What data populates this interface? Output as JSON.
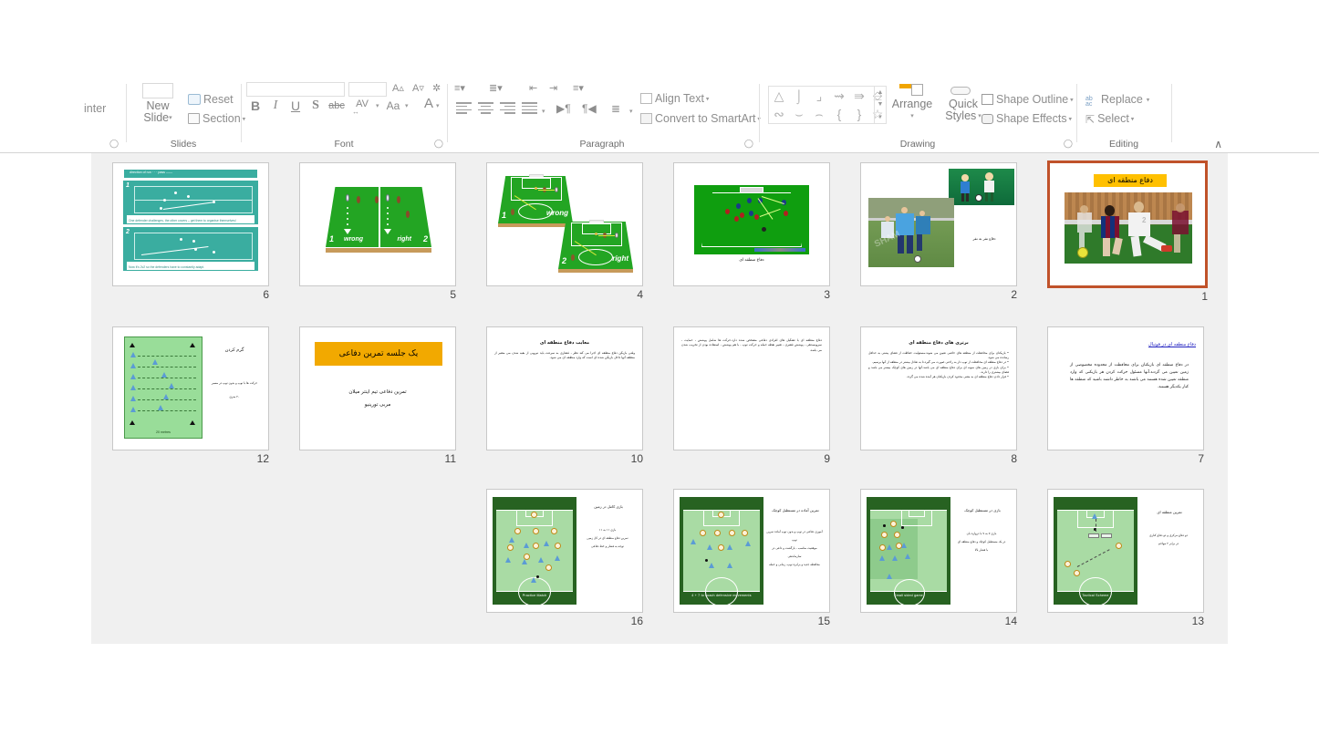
{
  "app": {
    "name": "PowerPoint",
    "view": "slide-sorter"
  },
  "ribbon": {
    "groups": [
      {
        "label": "Slides"
      },
      {
        "label": "Font"
      },
      {
        "label": "Paragraph"
      },
      {
        "label": "Drawing"
      },
      {
        "label": "Editing"
      }
    ],
    "clipboard": {
      "painter_label": "inter"
    },
    "slides_group": {
      "new_slide_line1": "New",
      "new_slide_line2": "Slide",
      "reset_label": "Reset",
      "section_label": "Section",
      "label": "Slides"
    },
    "font_group": {
      "bold": "B",
      "italic": "I",
      "underline": "U",
      "shadow": "S",
      "strikethrough": "abc",
      "char_spacing": "AV",
      "change_case": "Aa",
      "font_color": "A",
      "label": "Font"
    },
    "paragraph_group": {
      "align_text_label": "Align Text",
      "convert_smartart_label": "Convert to SmartArt",
      "label": "Paragraph"
    },
    "drawing_group": {
      "arrange_label": "Arrange",
      "quick_styles_line1": "Quick",
      "quick_styles_line2": "Styles",
      "shape_outline_label": "Shape Outline",
      "shape_effects_label": "Shape Effects",
      "label": "Drawing"
    },
    "editing_group": {
      "replace_label": "Replace",
      "replace_icon_top": "ab",
      "replace_icon_bottom": "ac",
      "select_label": "Select",
      "label": "Editing"
    },
    "collapse_chevron": "∧"
  },
  "theme": {
    "selection_border": "#c0522a",
    "sorter_background": "#f0f0f0",
    "slide1_title_highlight": "#ffc000",
    "slide11_banner": "#f2a900",
    "link_heading_color": "#2020c0",
    "pitch_dark_green": "#276221",
    "pitch_light_green": "#a9dba4",
    "teal_diagram": "#3aada0"
  },
  "slides": [
    {
      "number": "1",
      "selected": true,
      "kind": "title-photo",
      "title": "دفاع منطقه ای",
      "photo_caption": ""
    },
    {
      "number": "2",
      "selected": false,
      "kind": "two-photos",
      "caption": "دفاع نفر به نفر"
    },
    {
      "number": "3",
      "selected": false,
      "kind": "pitch-green-3d",
      "caption": "دفاع منطقه ای"
    },
    {
      "number": "4",
      "selected": false,
      "kind": "two-pitch-3d",
      "label_wrong": "wrong",
      "label_right": "right",
      "num_left": "1",
      "num_right": "2"
    },
    {
      "number": "5",
      "selected": false,
      "kind": "split-pitch-3d",
      "label_wrong": "wrong",
      "label_right": "right",
      "num_left": "1",
      "num_right": "2"
    },
    {
      "number": "6",
      "selected": false,
      "kind": "teal-tactics",
      "header": "direction of run   · · ·  pass  ——",
      "panel1_num": "1",
      "panel1_text": "One defender challenges, the other covers – get them to organise themselves!",
      "panel2_num": "2",
      "panel2_text": "Now it's 2v2 so the defenders have to constantly adapt."
    },
    {
      "number": "7",
      "selected": false,
      "kind": "text-slide",
      "heading": "دفاع منطقه ای در فوتبال",
      "heading_style": "link",
      "body": "در دفاع منطقه ای بازیکنان برای محافظت از محدوده مخصوصی از زمین تعیین می گردند.آنها مسئول حرکت کردن هر بازیکنی که وارد منطقه تعیین شده هستند می باشند به خاطر داشته باشید که منطقه ها کنار یکدیگر هستند."
    },
    {
      "number": "8",
      "selected": false,
      "kind": "text-slide",
      "heading": "برتری های دفاع منطقه ای",
      "heading_style": "plain",
      "body": "• بازیکنان برای محافظت از منطقه های خاصی تعیین می شوند.مسئولیت حفاظت از فضای پشتی به حداقل رسانده می شود.\n• در دفاع منطقه ای محافظت از توپ دار به راحتی صورت می گیرد.تا به تعادل بیشتر در منطقه از آنها برسیم.\n• برای بازی در زمین های نمونه ای برای دفاع منطقه ای می باشد.آنها در زمین های کوچک بیشتر می باشد و فضای بیشتری را دارند.\n• قرار دادن دفاع منطقه ای به معنی محدود کردن بازیکنان هر آمده شده می گردد."
    },
    {
      "number": "9",
      "selected": false,
      "kind": "text-slide",
      "heading": "",
      "heading_style": "none",
      "body": "دفاع منطقه ای با تشکیل های افرادی دفاعی مشخص شده دارد.حرکت ها شامل پوشش ، حمایت ، سرویسدهی ، پوشش فشری ، تغییر نقطه حمله و حرکت توپ ، با هم پوشش ، استفاده بودن از تخریب شدن می باشد."
    },
    {
      "number": "10",
      "selected": false,
      "kind": "text-slide",
      "heading": "معایب دفاع منطقه ای",
      "heading_style": "plain",
      "body": "وقتی بازیکن دفاع منطقه ای اجرا می کند نظر ، فشاری به سرعت باید نیرویی از بقیه شدن می معتبر از منطقه آنها داخل بازیکن شده ای است که وارد منطقه ای می شود."
    },
    {
      "number": "11",
      "selected": false,
      "kind": "banner-slide",
      "banner_title": "یک جلسه تمرین دفاعی",
      "sub1": "تمرین دفاعی تیم اینتر میلان",
      "sub2": "مربی تورینیو"
    },
    {
      "number": "12",
      "selected": false,
      "kind": "green-grid-drill",
      "heading": "گرم کردن",
      "body": "حرکت ها با توپ و بدون توپ در مسیر",
      "body2": "۲۰ متری",
      "field_caption": "20 metres"
    },
    {
      "number": "13",
      "selected": false,
      "kind": "pitch-vertical",
      "heading": "تمرین منطقه ای",
      "body": "دو دفاع مرکزی و دو دفاع کناری\nدر برابر ۲ مهاجم",
      "field_caption": "Tactical Scheme"
    },
    {
      "number": "14",
      "selected": false,
      "kind": "pitch-vertical",
      "heading": "بازی در مستطیل کوچک",
      "body": "بازی ۷ به ۷ با دروازه بان\nدر یک مستطیل کوچک و دفاع منطقه ای\nبا فشار بالا",
      "field_caption": "Small sided game"
    },
    {
      "number": "15",
      "selected": false,
      "kind": "pitch-vertical",
      "heading": "تمرین آماده در مستطیل کوچک",
      "body": "آموزی دفاعی در توپ و بدون توپ آماده تمرین توپ\nموقعیت مناسب ، بازگشت و داعی در سازماندهی\nمحافظه جدید و برابره توپ، زمانی و حمله",
      "field_caption": "4 + 7 to coach defensive movements"
    },
    {
      "number": "16",
      "selected": false,
      "kind": "pitch-vertical",
      "heading": "بازی کامل در زمین",
      "body": "بازی ۱۱ به ۱۱\nتمرین دفاع منطقه ای در کل زمین\nتوجه به فشار و خط دفاعی",
      "field_caption": "Practice Match"
    }
  ]
}
